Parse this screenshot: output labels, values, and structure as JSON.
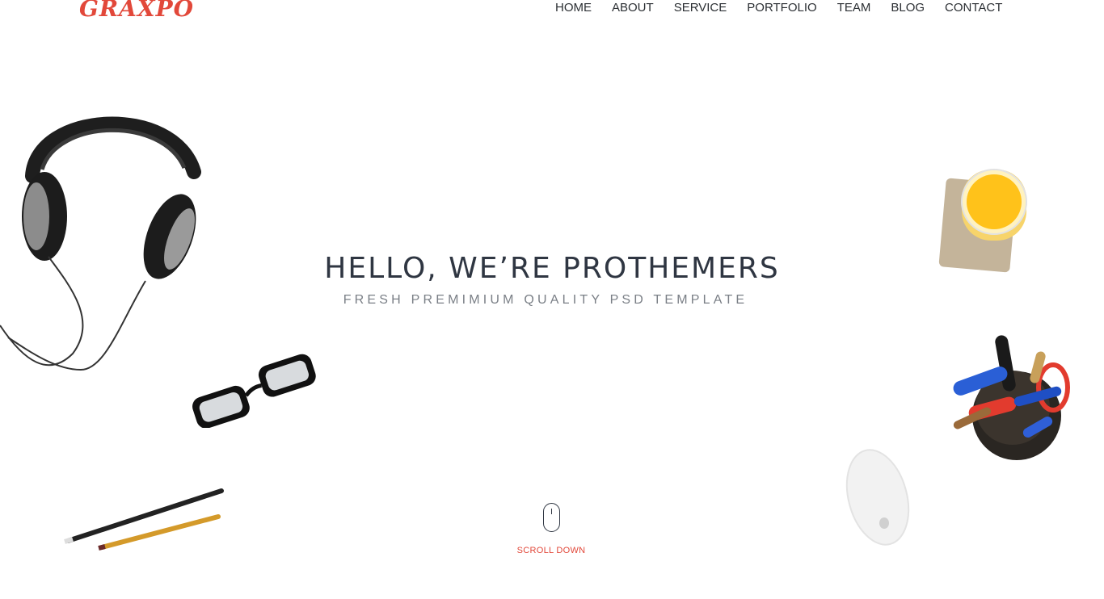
{
  "brand": {
    "logo_text": "GRAXPO",
    "accent_color": "#e2483a"
  },
  "nav": {
    "items": [
      {
        "label": "HOME"
      },
      {
        "label": "ABOUT"
      },
      {
        "label": "SERVICE"
      },
      {
        "label": "PORTFOLIO"
      },
      {
        "label": "TEAM"
      },
      {
        "label": "BLOG"
      },
      {
        "label": "CONTACT"
      }
    ]
  },
  "hero": {
    "title": "HELLO, WE’RE PROTHEMERS",
    "subtitle": "FRESH PREMIMIUM QUALITY PSD TEMPLATE"
  },
  "scroll": {
    "label": "SCROLL DOWN",
    "icon": "mouse-icon"
  },
  "decorations": [
    "headphones",
    "glasses",
    "pencils",
    "juice-glass",
    "pen-cup",
    "computer-mouse"
  ]
}
